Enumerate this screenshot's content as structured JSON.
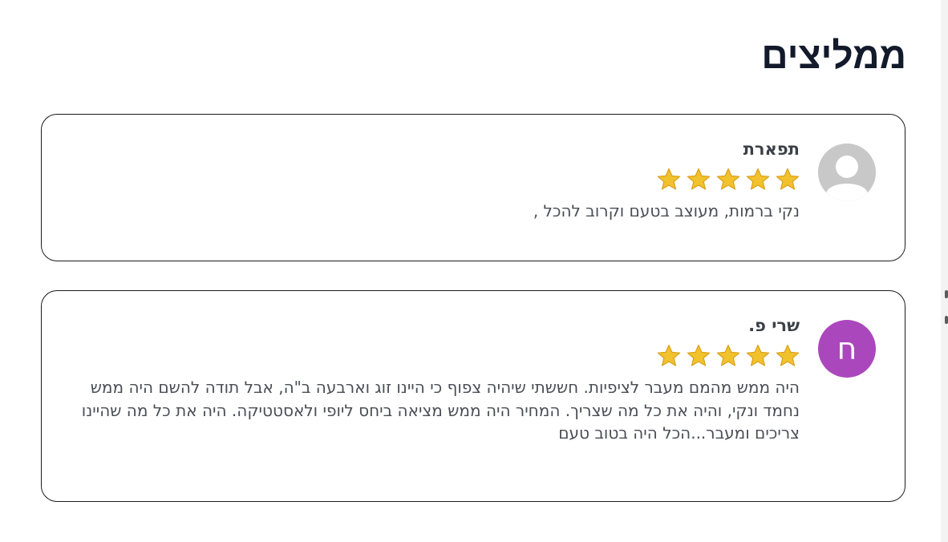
{
  "section": {
    "title": "ממליצים"
  },
  "reviews": [
    {
      "name": "תפארת",
      "avatar_type": "default-user-icon",
      "avatar_letter": "",
      "rating": 5,
      "max_rating": 5,
      "text": "נקי ברמות, מעוצב בטעם וקרוב להכל ,"
    },
    {
      "name": "שרי פ.",
      "avatar_type": "letter",
      "avatar_letter": "ח",
      "avatar_color": "#ab47bc",
      "rating": 5,
      "max_rating": 5,
      "text": "היה ממש מהמם מעבר לציפיות. חששתי שיהיה צפוף כי היינו זוג וארבעה ב\"ה, אבל תודה להשם היה ממש נחמד ונקי, והיה את כל מה שצריך. המחיר היה ממש מציאה ביחס ליופי ולאסטטיקה. היה את כל מה שהיינו צריכים ומעבר...הכל היה בטוב טעם"
    }
  ],
  "colors": {
    "star": "#f2c12e",
    "avatar_default": "#c8c8c8",
    "title": "#121a2b",
    "text": "#4a4e55",
    "card_border": "#1b1b1b"
  }
}
